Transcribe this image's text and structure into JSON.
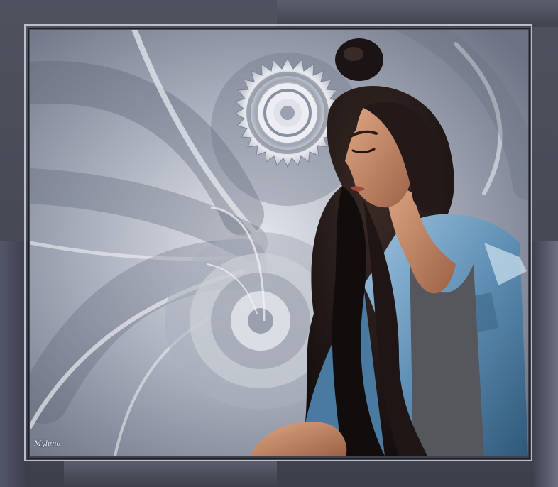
{
  "artwork": {
    "signature": "Mylène",
    "colors": {
      "frame": "#454955",
      "frame_highlight": "#b9bfcc",
      "background_light": "#d7dbe3",
      "background_dark": "#707686",
      "hair": "#1c1414",
      "skin": "#c98c6b",
      "jacket": "#5f8fb5",
      "top": "#55575c"
    },
    "elements": [
      "gray-frame",
      "spiral-fractal-background",
      "woman-figure",
      "signature"
    ]
  }
}
